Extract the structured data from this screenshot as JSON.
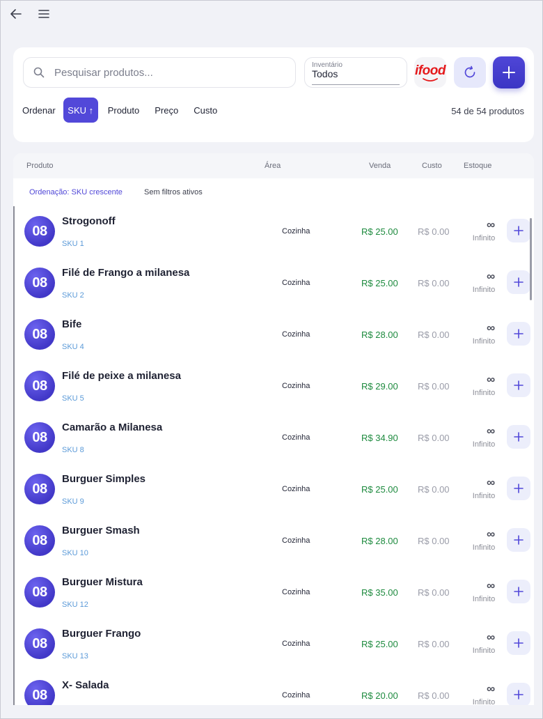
{
  "search": {
    "placeholder": "Pesquisar produtos..."
  },
  "inventory": {
    "label": "Inventário",
    "value": "Todos"
  },
  "ifood": {
    "logo_text": "ifood"
  },
  "sort": {
    "label": "Ordenar",
    "active": "SKU ↑",
    "options": [
      "Produto",
      "Preço",
      "Custo"
    ]
  },
  "count_text": "54 de 54 produtos",
  "table": {
    "headers": {
      "product": "Produto",
      "area": "Área",
      "sale": "Venda",
      "cost": "Custo",
      "stock": "Estoque"
    },
    "sort_info": "Ordenação: SKU crescente",
    "filter_info": "Sem filtros ativos"
  },
  "products": [
    {
      "badge": "08",
      "name": "Strogonoff",
      "sku": "SKU 1",
      "area": "Cozinha",
      "sale": "R$ 25.00",
      "cost": "R$ 0.00",
      "stock_symbol": "∞",
      "stock_label": "Infinito"
    },
    {
      "badge": "08",
      "name": "Filé de Frango a milanesa",
      "sku": "SKU 2",
      "area": "Cozinha",
      "sale": "R$ 25.00",
      "cost": "R$ 0.00",
      "stock_symbol": "∞",
      "stock_label": "Infinito"
    },
    {
      "badge": "08",
      "name": "Bife",
      "sku": "SKU 4",
      "area": "Cozinha",
      "sale": "R$ 28.00",
      "cost": "R$ 0.00",
      "stock_symbol": "∞",
      "stock_label": "Infinito"
    },
    {
      "badge": "08",
      "name": "Filé de peixe a milanesa",
      "sku": "SKU 5",
      "area": "Cozinha",
      "sale": "R$ 29.00",
      "cost": "R$ 0.00",
      "stock_symbol": "∞",
      "stock_label": "Infinito"
    },
    {
      "badge": "08",
      "name": "Camarão a Milanesa",
      "sku": "SKU 8",
      "area": "Cozinha",
      "sale": "R$ 34.90",
      "cost": "R$ 0.00",
      "stock_symbol": "∞",
      "stock_label": "Infinito"
    },
    {
      "badge": "08",
      "name": "Burguer Simples",
      "sku": "SKU 9",
      "area": "Cozinha",
      "sale": "R$ 25.00",
      "cost": "R$ 0.00",
      "stock_symbol": "∞",
      "stock_label": "Infinito"
    },
    {
      "badge": "08",
      "name": "Burguer Smash",
      "sku": "SKU 10",
      "area": "Cozinha",
      "sale": "R$ 28.00",
      "cost": "R$ 0.00",
      "stock_symbol": "∞",
      "stock_label": "Infinito"
    },
    {
      "badge": "08",
      "name": "Burguer Mistura",
      "sku": "SKU 12",
      "area": "Cozinha",
      "sale": "R$ 35.00",
      "cost": "R$ 0.00",
      "stock_symbol": "∞",
      "stock_label": "Infinito"
    },
    {
      "badge": "08",
      "name": "Burguer Frango",
      "sku": "SKU 13",
      "area": "Cozinha",
      "sale": "R$ 25.00",
      "cost": "R$ 0.00",
      "stock_symbol": "∞",
      "stock_label": "Infinito"
    },
    {
      "badge": "08",
      "name": "X- Salada",
      "sku": "",
      "area": "Cozinha",
      "sale": "R$ 20.00",
      "cost": "R$ 0.00",
      "stock_symbol": "∞",
      "stock_label": "Infinito"
    }
  ],
  "colors": {
    "accent": "#5248d9",
    "sale": "#1d8a3e",
    "sku": "#5b9ad8",
    "ifood": "#e5191b"
  }
}
